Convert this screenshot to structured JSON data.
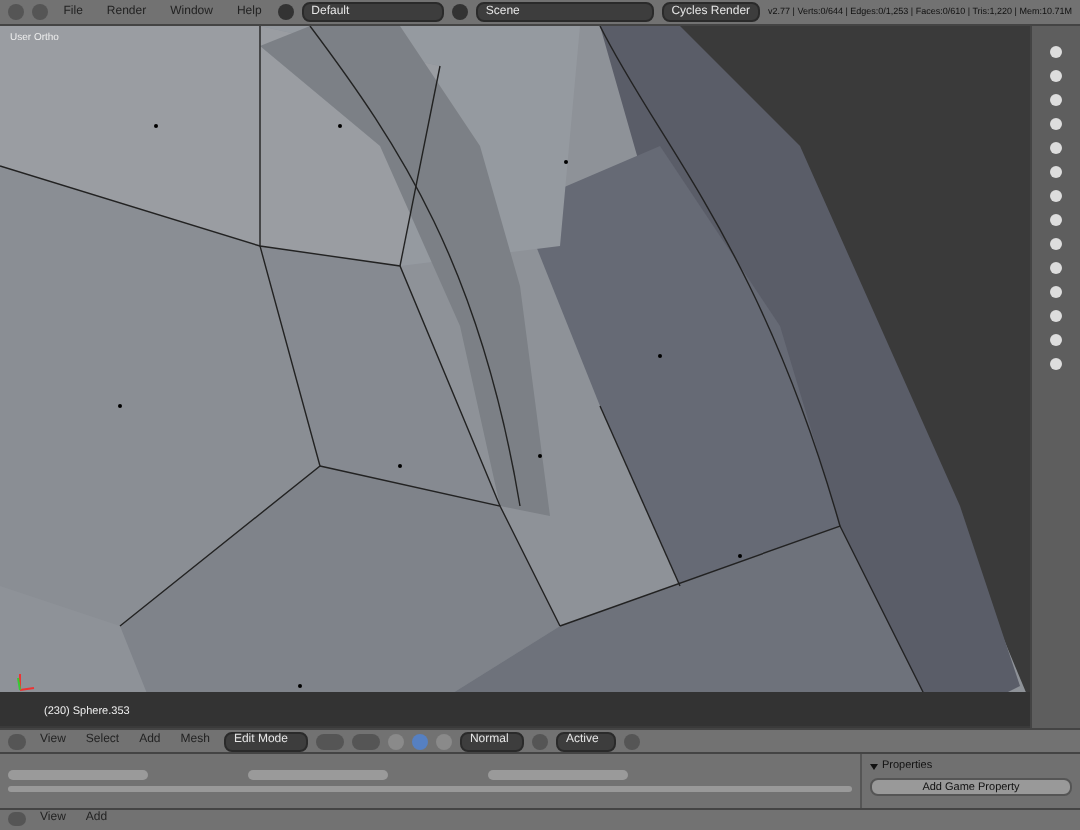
{
  "top_bar": {
    "menus": [
      "File",
      "Render",
      "Window",
      "Help"
    ],
    "layout": "Default",
    "scene": "Scene",
    "engine": "Cycles Render",
    "stats": "v2.77 | Verts:0/644 | Edges:0/1,253 | Faces:0/610 | Tris:1,220 | Mem:10.71M"
  },
  "viewport": {
    "view_label": "User Ortho",
    "object_label": "(230) Sphere.353"
  },
  "header": {
    "menus": [
      "View",
      "Select",
      "Add",
      "Mesh"
    ],
    "mode": "Edit Mode",
    "orientation": "Normal",
    "pivot": "Active",
    "select_modes": [
      {
        "selected": false
      },
      {
        "selected": true
      },
      {
        "selected": false
      }
    ]
  },
  "properties": {
    "title": "Properties",
    "button": "Add Game Property"
  },
  "bottom_header": {
    "menus": [
      "View",
      "Add"
    ]
  }
}
